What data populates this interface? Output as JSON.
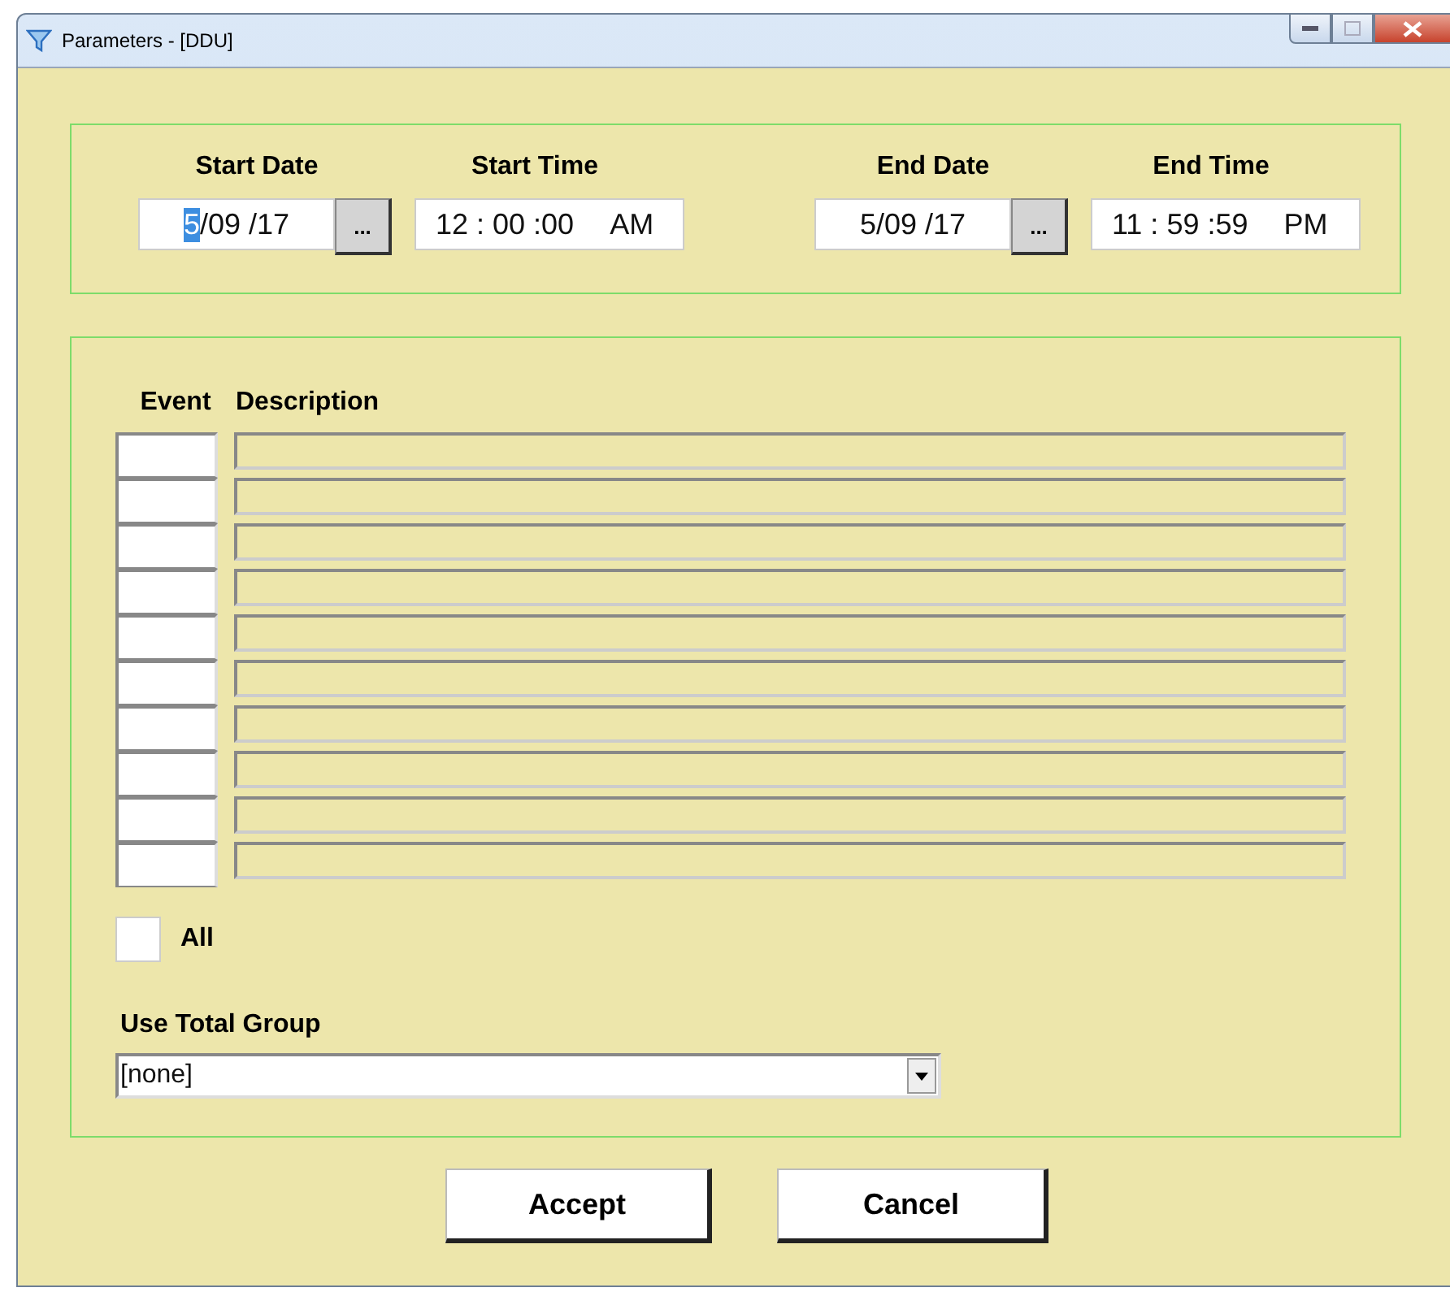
{
  "window": {
    "title": "Parameters - [DDU]"
  },
  "range": {
    "fields": [
      {
        "kind": "date",
        "label": "Start Date",
        "month": "5",
        "month_selected": true,
        "rest": "/09 /17",
        "picker": "..."
      },
      {
        "kind": "time",
        "label": "Start Time",
        "time": "12 : 00 :00",
        "ampm": "AM"
      },
      {
        "kind": "date",
        "label": "End Date",
        "month": "5",
        "month_selected": false,
        "rest": "/09 /17",
        "picker": "..."
      },
      {
        "kind": "time",
        "label": "End Time",
        "time": "11 : 59 :59",
        "ampm": "PM"
      }
    ]
  },
  "events": {
    "event_heading": "Event",
    "description_heading": "Description",
    "rows": [
      {
        "kind": "blank_row"
      },
      {
        "kind": "blank_row"
      },
      {
        "kind": "blank_row"
      },
      {
        "kind": "blank_row"
      },
      {
        "kind": "blank_row"
      },
      {
        "kind": "blank_row"
      },
      {
        "kind": "blank_row"
      },
      {
        "kind": "blank_row"
      },
      {
        "kind": "blank_row"
      },
      {
        "kind": "blank_row"
      }
    ],
    "all": {
      "label": "All",
      "checked": false
    },
    "total_group": {
      "label": "Use Total Group",
      "value": "[none]"
    }
  },
  "buttons": [
    "Accept",
    "Cancel"
  ]
}
